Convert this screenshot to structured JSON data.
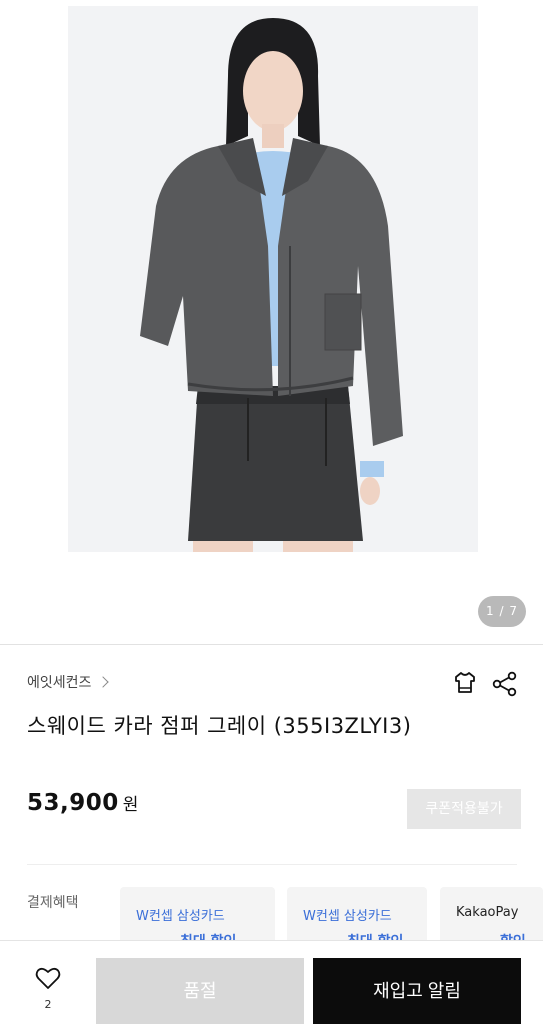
{
  "gallery": {
    "image_alt": "Model wearing a gray suede collared cropped jumper over a light blue sweater and a black denim mini skirt",
    "counter": "1 / 7"
  },
  "product": {
    "brand": "에잇세컨즈",
    "title": "스웨이드 카라 점퍼 그레이 (355I3ZLYI3)",
    "price": "53,900",
    "currency": "원",
    "coupon_label": "쿠폰적용불가"
  },
  "benefits": {
    "label": "결제혜택",
    "cards": [
      {
        "name": "W컨셉 삼성카드",
        "sub": "최대 할인"
      },
      {
        "name": "W컨셉 삼성카드",
        "sub": "최대 할인"
      },
      {
        "name": "KakaoPay",
        "sub": "할인"
      }
    ]
  },
  "bottom": {
    "like_count": "2",
    "soldout_label": "품절",
    "restock_label": "재입고 알림"
  },
  "colors": {
    "accent_blue": "#3b6fd8",
    "button_dark": "#0c0c0c",
    "button_disabled": "#d8d8d8"
  },
  "icons": [
    "hanger-icon",
    "share-icon",
    "heart-icon",
    "chevron-right-icon"
  ]
}
